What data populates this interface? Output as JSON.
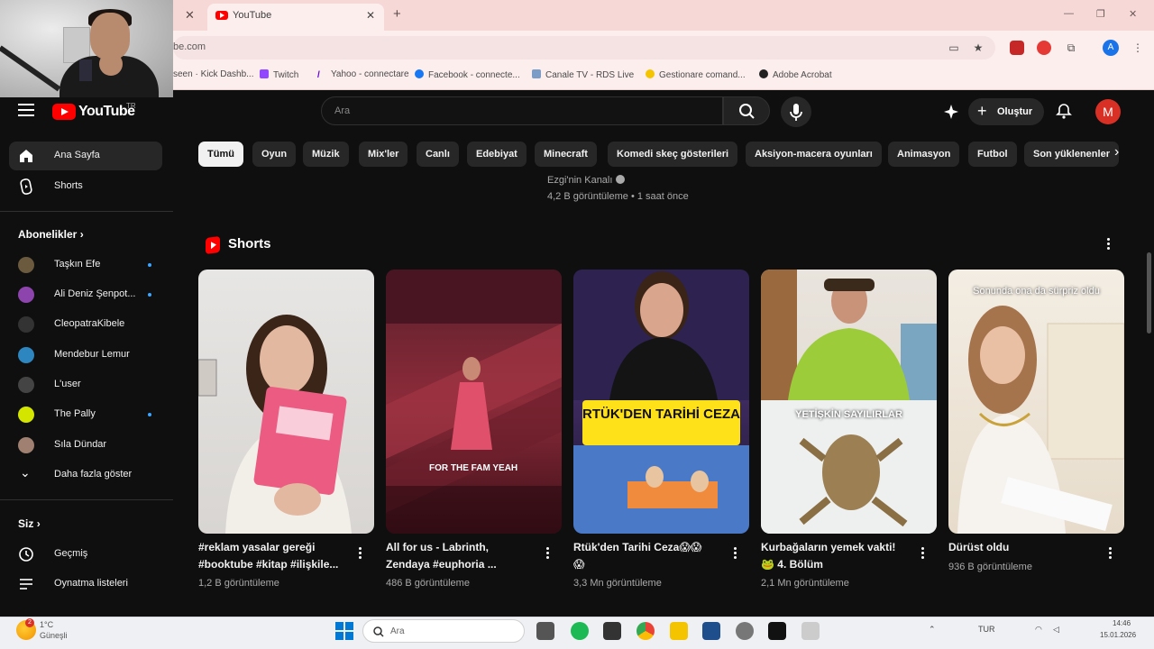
{
  "browser": {
    "tab_title": "YouTube",
    "url": "be.com",
    "profile_initial": "A",
    "bookmarks": [
      "seen · Kick Dashb...",
      "Twitch",
      "Yahoo - connectare",
      "Facebook - connecte...",
      "Canale TV - RDS Live",
      "Gestionare comand...",
      "Adobe Acrobat"
    ]
  },
  "header": {
    "logo_word": "YouTube",
    "country": "TR",
    "search_placeholder": "Ara",
    "create_label": "Oluştur",
    "avatar_initial": "M"
  },
  "sidebar": {
    "home": "Ana Sayfa",
    "shorts": "Shorts",
    "subs_heading": "Abonelikler",
    "subscriptions": [
      {
        "name": "Taşkın Efe",
        "live": true,
        "color": "#6b5a3e"
      },
      {
        "name": "Ali Deniz Şenpot...",
        "live": true,
        "color": "#8e44ad"
      },
      {
        "name": "CleopatraKibele",
        "live": false,
        "color": "#333333"
      },
      {
        "name": "Mendebur Lemur",
        "live": false,
        "color": "#2e86c1"
      },
      {
        "name": "L'user",
        "live": false,
        "color": "#444444"
      },
      {
        "name": "The Pally",
        "live": true,
        "color": "#d4e600"
      },
      {
        "name": "Sıla Dündar",
        "live": false,
        "color": "#a08070"
      }
    ],
    "show_more": "Daha fazla göster",
    "you_heading": "Siz",
    "history": "Geçmiş",
    "playlists": "Oynatma listeleri"
  },
  "chips": [
    "Tümü",
    "Oyun",
    "Müzik",
    "Mix'ler",
    "Canlı",
    "Edebiyat",
    "Minecraft",
    "Komedi skeç gösterileri",
    "Aksiyon-macera oyunları",
    "Animasyon",
    "Futbol",
    "Son yüklenenler"
  ],
  "previous_video": {
    "channel": "Ezgi'nin Kanalı",
    "meta": "4,2 B görüntüleme • 1 saat önce"
  },
  "shorts_section": {
    "title": "Shorts",
    "items": [
      {
        "title_line1": "#reklam yasalar gereği",
        "title_line2": "#booktube #kitap #ilişkile...",
        "views": "1,2 B görüntüleme"
      },
      {
        "title_line1": "All for us - Labrinth,",
        "title_line2": "Zendaya #euphoria ...",
        "views": "486 B görüntüleme",
        "overlay": "FOR THE FAM YEAH"
      },
      {
        "title_line1": "Rtük'den Tarihi Ceza😱😱",
        "title_line2": "😱",
        "views": "3,3 Mn görüntüleme",
        "overlay": "RTÜK'DEN TARİHİ CEZA"
      },
      {
        "title_line1": "Kurbağaların yemek vakti!",
        "title_line2": "🐸 4. Bölüm",
        "views": "2,1 Mn görüntüleme",
        "overlay": "YETİŞKİN SAYILIRLAR"
      },
      {
        "title_line1": "Dürüst oldu",
        "title_line2": "",
        "views": "936 B görüntüleme",
        "overlay": "Sonunda ona da sürpriz oldu"
      }
    ]
  },
  "taskbar": {
    "weather_temp": "1°C",
    "weather_desc": "Güneşli",
    "weather_badge": "2",
    "search_placeholder": "Ara",
    "lang": "TUR",
    "time": "14:46",
    "date": "15.01.2026"
  }
}
